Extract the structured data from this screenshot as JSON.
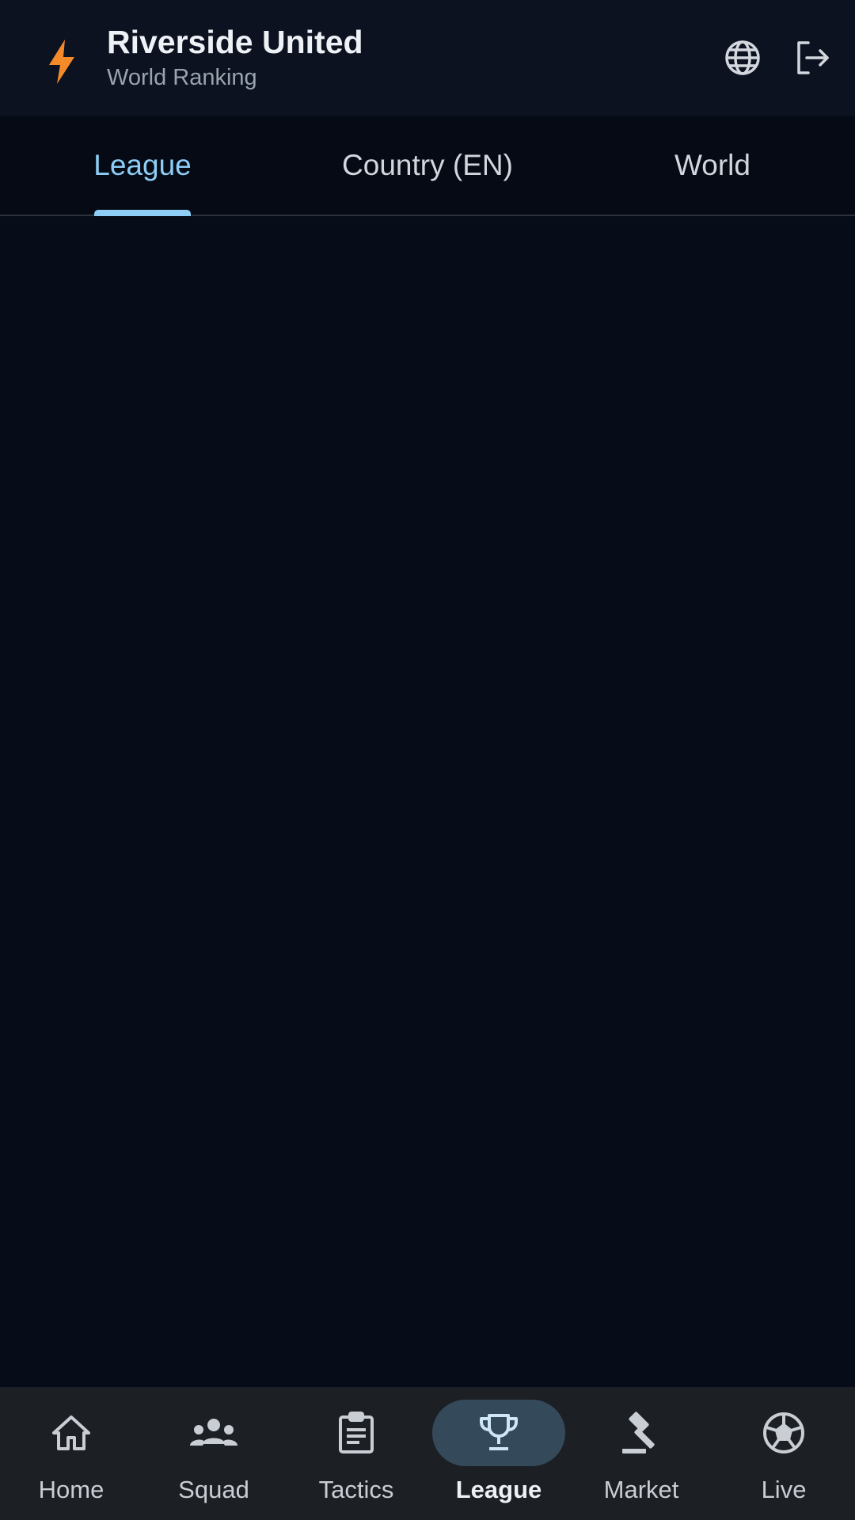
{
  "header": {
    "title": "Riverside United",
    "subtitle": "World Ranking",
    "logo_icon": "lightning-bolt-icon",
    "logo_color": "#f58a2a",
    "actions": [
      {
        "icon": "globe-icon"
      },
      {
        "icon": "logout-icon"
      }
    ]
  },
  "tabs": [
    {
      "label": "League",
      "selected": true
    },
    {
      "label": "Country (EN)",
      "selected": false
    },
    {
      "label": "World",
      "selected": false
    }
  ],
  "colors": {
    "accent": "#8ecdf6",
    "background": "#070c17",
    "nav_active_pill": "#344a5b"
  },
  "bottom_nav": [
    {
      "label": "Home",
      "icon": "home-icon",
      "active": false
    },
    {
      "label": "Squad",
      "icon": "group-icon",
      "active": false
    },
    {
      "label": "Tactics",
      "icon": "clipboard-icon",
      "active": false
    },
    {
      "label": "League",
      "icon": "trophy-icon",
      "active": true
    },
    {
      "label": "Market",
      "icon": "gavel-icon",
      "active": false
    },
    {
      "label": "Live",
      "icon": "soccer-ball-icon",
      "active": false
    }
  ]
}
